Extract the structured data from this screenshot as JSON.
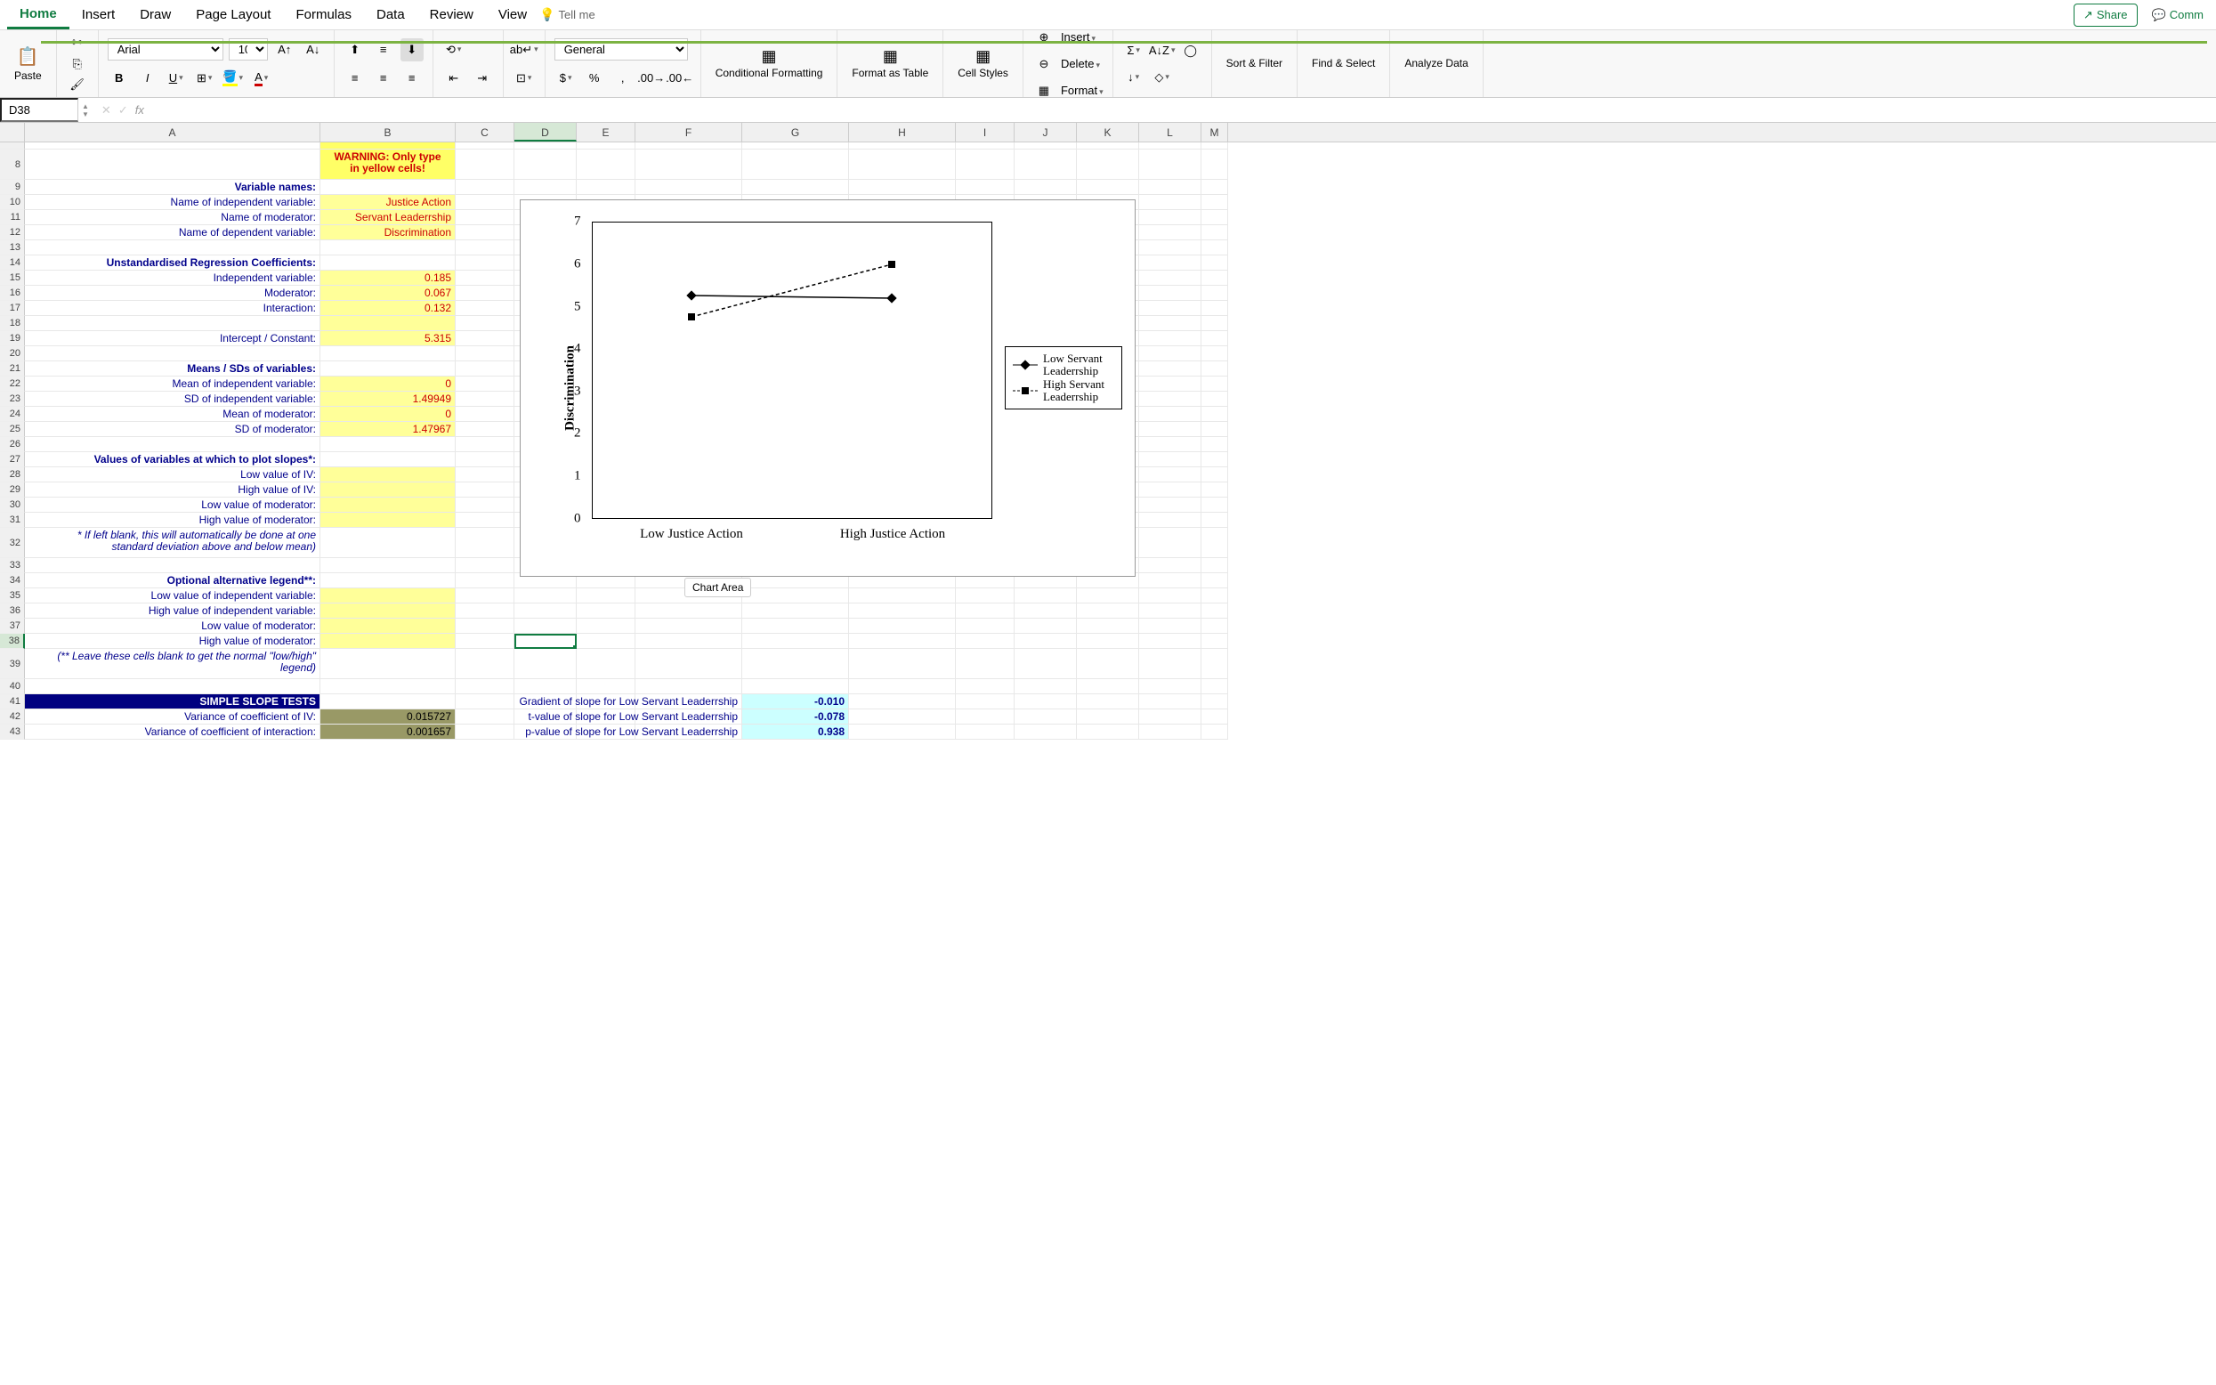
{
  "ribbon": {
    "tabs": [
      "Home",
      "Insert",
      "Draw",
      "Page Layout",
      "Formulas",
      "Data",
      "Review",
      "View"
    ],
    "tellme": "Tell me",
    "share": "Share",
    "comments": "Comm",
    "paste": "Paste",
    "font_name": "Arial",
    "font_size": "10",
    "number_format": "General",
    "conditional_formatting": "Conditional Formatting",
    "format_as_table": "Format as Table",
    "cell_styles": "Cell Styles",
    "insert": "Insert",
    "delete": "Delete",
    "format": "Format",
    "sort_filter": "Sort & Filter",
    "find_select": "Find & Select",
    "analyze_data": "Analyze Data"
  },
  "name_box": "D38",
  "columns": [
    "A",
    "B",
    "C",
    "D",
    "E",
    "F",
    "G",
    "H",
    "I",
    "J",
    "K",
    "L",
    "M"
  ],
  "warning_line1": "WARNING: Only type",
  "warning_line2": "in yellow cells!",
  "labels": {
    "variable_names": "Variable names:",
    "iv_name": "Name of independent variable:",
    "mod_name": "Name of moderator:",
    "dv_name": "Name of dependent variable:",
    "unstd": "Unstandardised Regression Coefficients:",
    "iv": "Independent variable:",
    "mod": "Moderator:",
    "interaction": "Interaction:",
    "intercept": "Intercept / Constant:",
    "means_sds": "Means / SDs of variables:",
    "mean_iv": "Mean of independent variable:",
    "sd_iv": "SD of independent variable:",
    "mean_mod": "Mean of moderator:",
    "sd_mod": "SD of moderator:",
    "values_plot": "Values of variables at which to plot slopes*:",
    "low_iv": "Low value of IV:",
    "high_iv": "High value of IV:",
    "low_mod": "Low value of moderator:",
    "high_mod": "High value of moderator:",
    "note1a": "* If left blank, this will automatically be done at one",
    "note1b": "standard deviation above and below mean)",
    "opt_legend": "Optional alternative legend**:",
    "low_iv_leg": "Low value of independent variable:",
    "high_iv_leg": "High value of independent variable:",
    "low_mod_leg": "Low value of moderator:",
    "high_mod_leg": "High value of moderator:",
    "note2a": "(** Leave these cells blank to get the normal \"low/high\"",
    "note2b": "legend)",
    "simple_slope": "SIMPLE SLOPE TESTS",
    "var_coef_iv": "Variance of coefficient of IV:",
    "var_coef_int": "Variance of coefficient of interaction:",
    "grad_low": "Gradient of slope for Low Servant Leaderrship",
    "t_low": "t-value of slope for Low Servant Leaderrship",
    "p_low": "p-value of slope for Low Servant Leaderrship"
  },
  "values": {
    "iv_name": "Justice Action",
    "mod_name": "Servant Leaderrship",
    "dv_name": "Discrimination",
    "iv_coef": "0.185",
    "mod_coef": "0.067",
    "int_coef": "0.132",
    "intercept": "5.315",
    "mean_iv": "0",
    "sd_iv": "1.49949",
    "mean_mod": "0",
    "sd_mod": "1.47967",
    "var_coef_iv": "0.015727",
    "var_coef_int": "0.001657",
    "grad_low": "-0.010",
    "t_low": "-0.078",
    "p_low": "0.938"
  },
  "chart_data": {
    "type": "line",
    "title": "",
    "xlabel": "",
    "ylabel": "Discrimination",
    "categories": [
      "Low Justice Action",
      "High Justice Action"
    ],
    "series": [
      {
        "name": "Low Servant Leaderrship",
        "values": [
          5.25,
          5.2
        ],
        "marker": "diamond",
        "dash": "solid"
      },
      {
        "name": "High Servant Leaderrship",
        "values": [
          4.75,
          6.0
        ],
        "marker": "square",
        "dash": "dashed"
      }
    ],
    "ylim": [
      0,
      7
    ],
    "yticks": [
      0,
      1,
      2,
      3,
      4,
      5,
      6,
      7
    ],
    "chart_area_tooltip": "Chart Area"
  }
}
